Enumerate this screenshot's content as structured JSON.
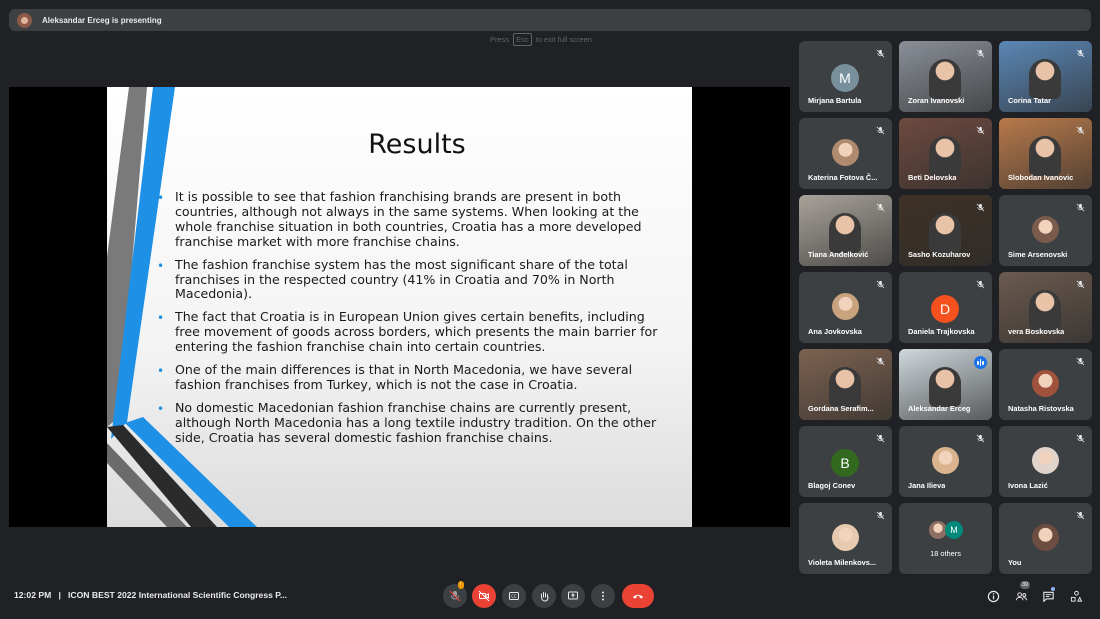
{
  "presenter": {
    "text": "Aleksandar Erceg is presenting"
  },
  "fullscreen_hint": {
    "press": "Press",
    "key": "Esc",
    "rest": "to exit full screen"
  },
  "slide": {
    "title": "Results",
    "bullets": [
      "It is possible to see that fashion franchising brands are present in both countries, although not always in the same systems. When looking at the whole franchise situation in both countries, Croatia has a more developed franchise market with more franchise chains.",
      "The fashion franchise system has the most significant share of the total franchises in the respected country (41% in Croatia and 70% in North Macedonia).",
      "The fact that Croatia is in European Union gives certain benefits, including free movement of goods across borders, which presents the main barrier for entering the fashion franchise chain into certain countries.",
      "One of the main differences is that in North Macedonia, we have several fashion franchises from Turkey, which is not the case in Croatia.",
      "No domestic Macedonian fashion franchise chains are currently present, although North Macedonia has a long textile industry tradition. On the other side, Croatia has several domestic fashion franchise chains."
    ]
  },
  "participants": [
    {
      "name": "Mirjana Bartula",
      "kind": "initial",
      "initial": "M",
      "color": "#78909c"
    },
    {
      "name": "Zoran Ivanovski",
      "kind": "video",
      "bg": "#8a8f98"
    },
    {
      "name": "Corina Tatar",
      "kind": "video",
      "bg": "#5b87b5"
    },
    {
      "name": "Katerina Fotova Č...",
      "kind": "photo",
      "color": "#b08a6e"
    },
    {
      "name": "Beti Delovska",
      "kind": "video",
      "bg": "#6d4a3f"
    },
    {
      "name": "Slobodan Ivanovic",
      "kind": "video",
      "bg": "#b87a4b"
    },
    {
      "name": "Tiana Anđelković",
      "kind": "video",
      "bg": "#a8a29a"
    },
    {
      "name": "Sasho Kozuharov",
      "kind": "video",
      "bg": "#3f3227"
    },
    {
      "name": "Sime Arsenovski",
      "kind": "photo",
      "color": "#7a5b4c"
    },
    {
      "name": "Ana Jovkovska",
      "kind": "photo",
      "color": "#c9a27e"
    },
    {
      "name": "Daniela Trajkovska",
      "kind": "initial",
      "initial": "D",
      "color": "#f4511e"
    },
    {
      "name": "vera Boskovska",
      "kind": "video",
      "bg": "#6b5a4f"
    },
    {
      "name": "Gordana Serafim...",
      "kind": "video",
      "bg": "#7d6250"
    },
    {
      "name": "Aleksandar Erceg",
      "kind": "video",
      "bg": "#cfd8dc"
    },
    {
      "name": "Natasha Ristovska",
      "kind": "photo",
      "color": "#a0523d"
    },
    {
      "name": "Blagoj Conev",
      "kind": "initial",
      "initial": "B",
      "color": "#33691e"
    },
    {
      "name": "Jana Ilieva",
      "kind": "photo",
      "color": "#d9b48f"
    },
    {
      "name": "Ivona Lazić",
      "kind": "photo",
      "color": "#e0d3cb"
    },
    {
      "name": "Violeta Milenkovs...",
      "kind": "photo",
      "color": "#e7c9b0"
    },
    {
      "name": "18 others",
      "kind": "others",
      "initial": "M",
      "color": "#00897b"
    },
    {
      "name": "You",
      "kind": "photo",
      "color": "#6d4c41"
    }
  ],
  "bottom": {
    "time": "12:02 PM",
    "separator": "|",
    "meeting": "ICON BEST 2022 International Scientific Congress P...",
    "mic_badge": "!",
    "people_count": "39"
  },
  "colors": {
    "accent": "#8ab4f8",
    "danger": "#ea4335",
    "tile": "#3c4043",
    "bg": "#202124"
  }
}
